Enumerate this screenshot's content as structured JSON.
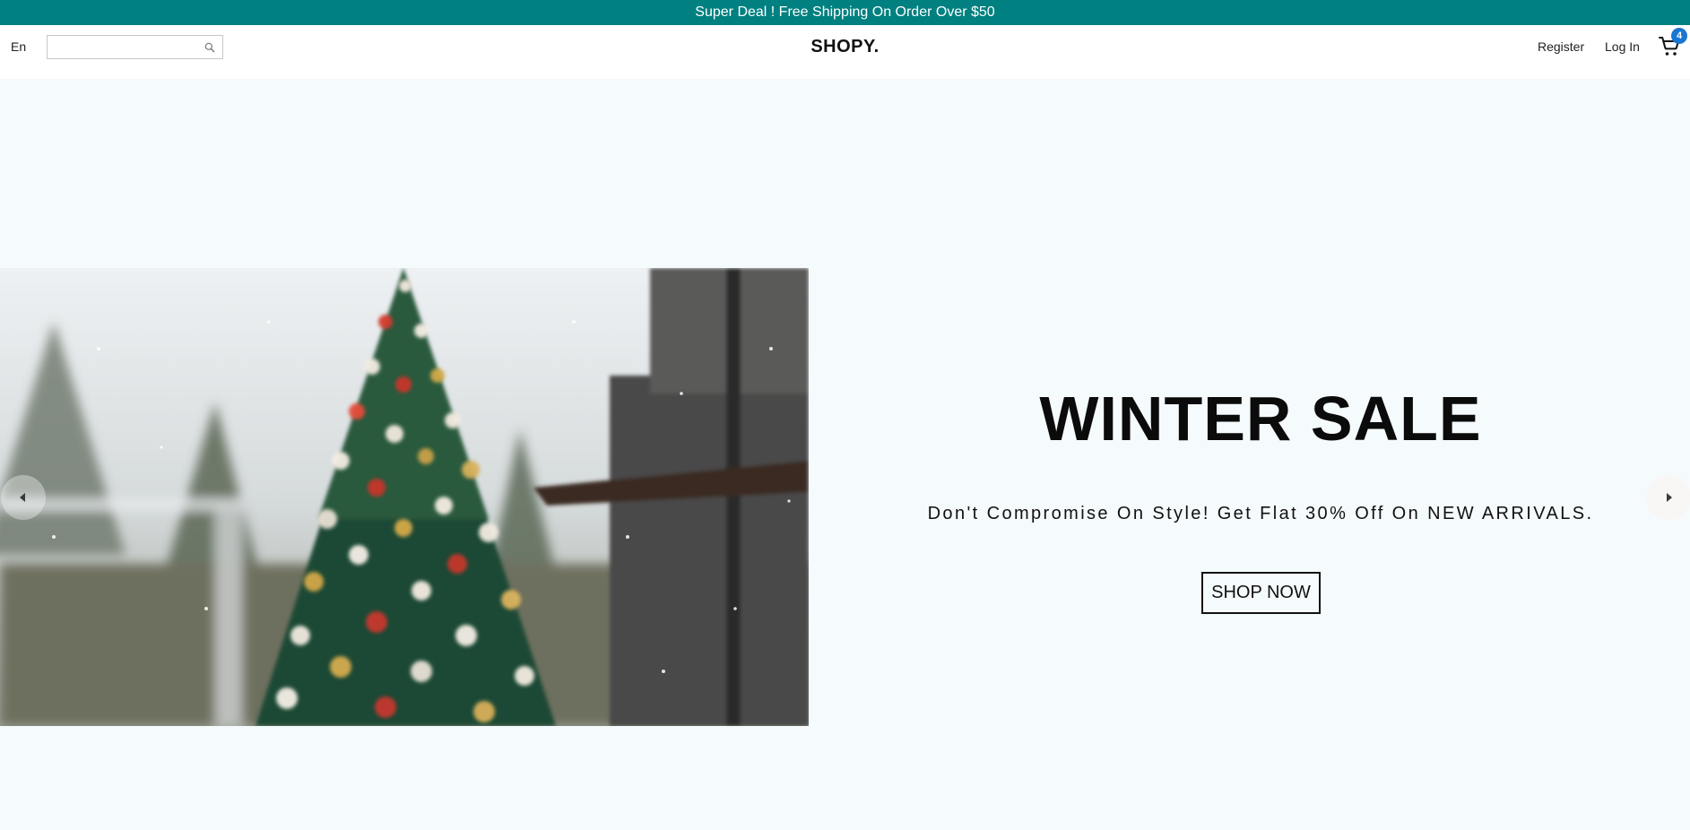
{
  "announcement": {
    "text": "Super Deal ! Free Shipping On Order Over $50"
  },
  "navbar": {
    "language": "En",
    "search": {
      "value": "",
      "placeholder": ""
    },
    "logo": "SHOPY.",
    "register_label": "Register",
    "login_label": "Log In",
    "cart_count": "4",
    "cart_icon": "shopping-cart-icon",
    "search_icon": "search-icon"
  },
  "slider": {
    "image": "christmas-tree-photo",
    "title": "WINTER SALE",
    "description": "Don't Compromise On Style! Get Flat 30% Off On NEW ARRIVALS.",
    "button_label": "SHOP NOW",
    "left_arrow_icon": "arrow-left-icon",
    "right_arrow_icon": "arrow-right-icon"
  },
  "colors": {
    "announcement_bg": "#008080",
    "page_bg": "#f5fafd",
    "badge_bg": "#1976d2"
  }
}
